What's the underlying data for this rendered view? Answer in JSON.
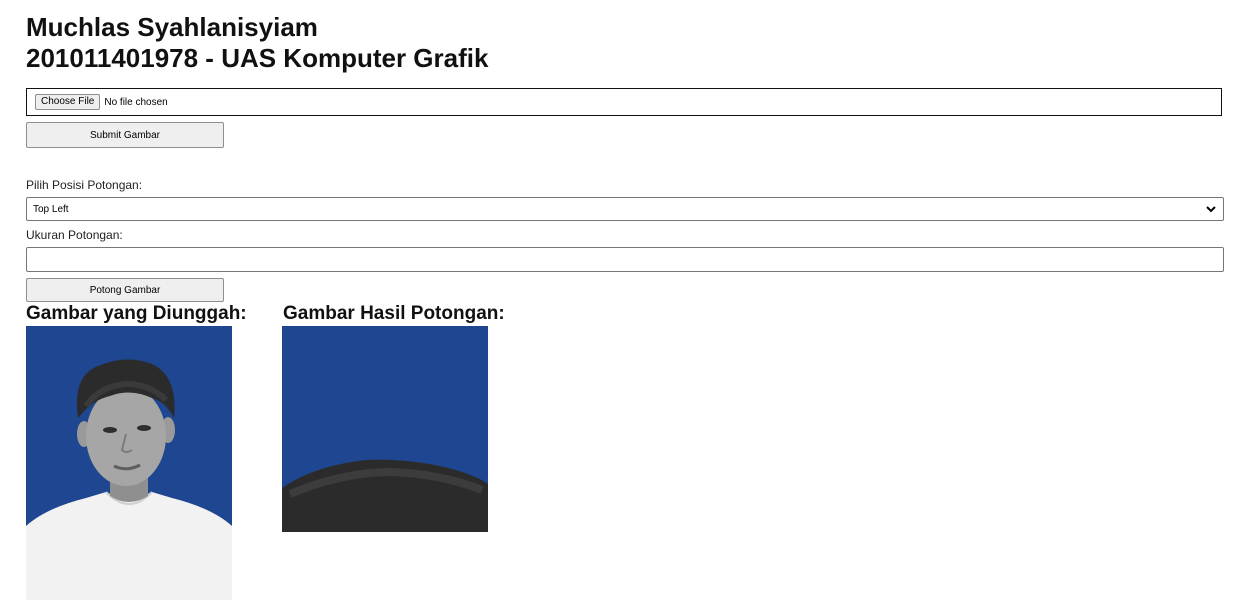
{
  "header": {
    "name": "Muchlas Syahlanisyiam",
    "subtitle": "201011401978 - UAS Komputer Grafik"
  },
  "upload": {
    "choose_label": "Choose File",
    "status": "No file chosen",
    "submit_label": "Submit Gambar"
  },
  "crop": {
    "position_label": "Pilih Posisi Potongan:",
    "position_value": "Top Left",
    "size_label": "Ukuran Potongan:",
    "size_value": "",
    "cut_label": "Potong Gambar"
  },
  "results": {
    "uploaded_heading": "Gambar yang Diunggah:",
    "cropped_heading": "Gambar Hasil Potongan:"
  },
  "colors": {
    "photo_background": "#1f4690",
    "hair": "#2b2b2b",
    "skin": "#a6a6a6",
    "shirt": "#f2f2f2"
  },
  "icons": {
    "select_arrow": "chevron-down-icon"
  }
}
